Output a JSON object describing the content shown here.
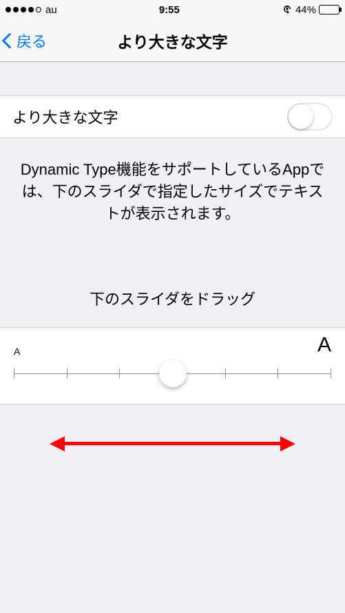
{
  "status": {
    "carrier": "au",
    "time": "9:55",
    "battery_pct": "44%"
  },
  "nav": {
    "back_label": "戻る",
    "title": "より大きな文字"
  },
  "setting": {
    "label": "より大きな文字",
    "toggle_on": false
  },
  "description": "Dynamic Type機能をサポートしているAppでは、下のスライダで指定したサイズでテキストが表示されます。",
  "drag_hint": "下のスライダをドラッグ",
  "slider": {
    "small_label": "A",
    "large_label": "A",
    "steps": 7,
    "position_pct": 50
  }
}
